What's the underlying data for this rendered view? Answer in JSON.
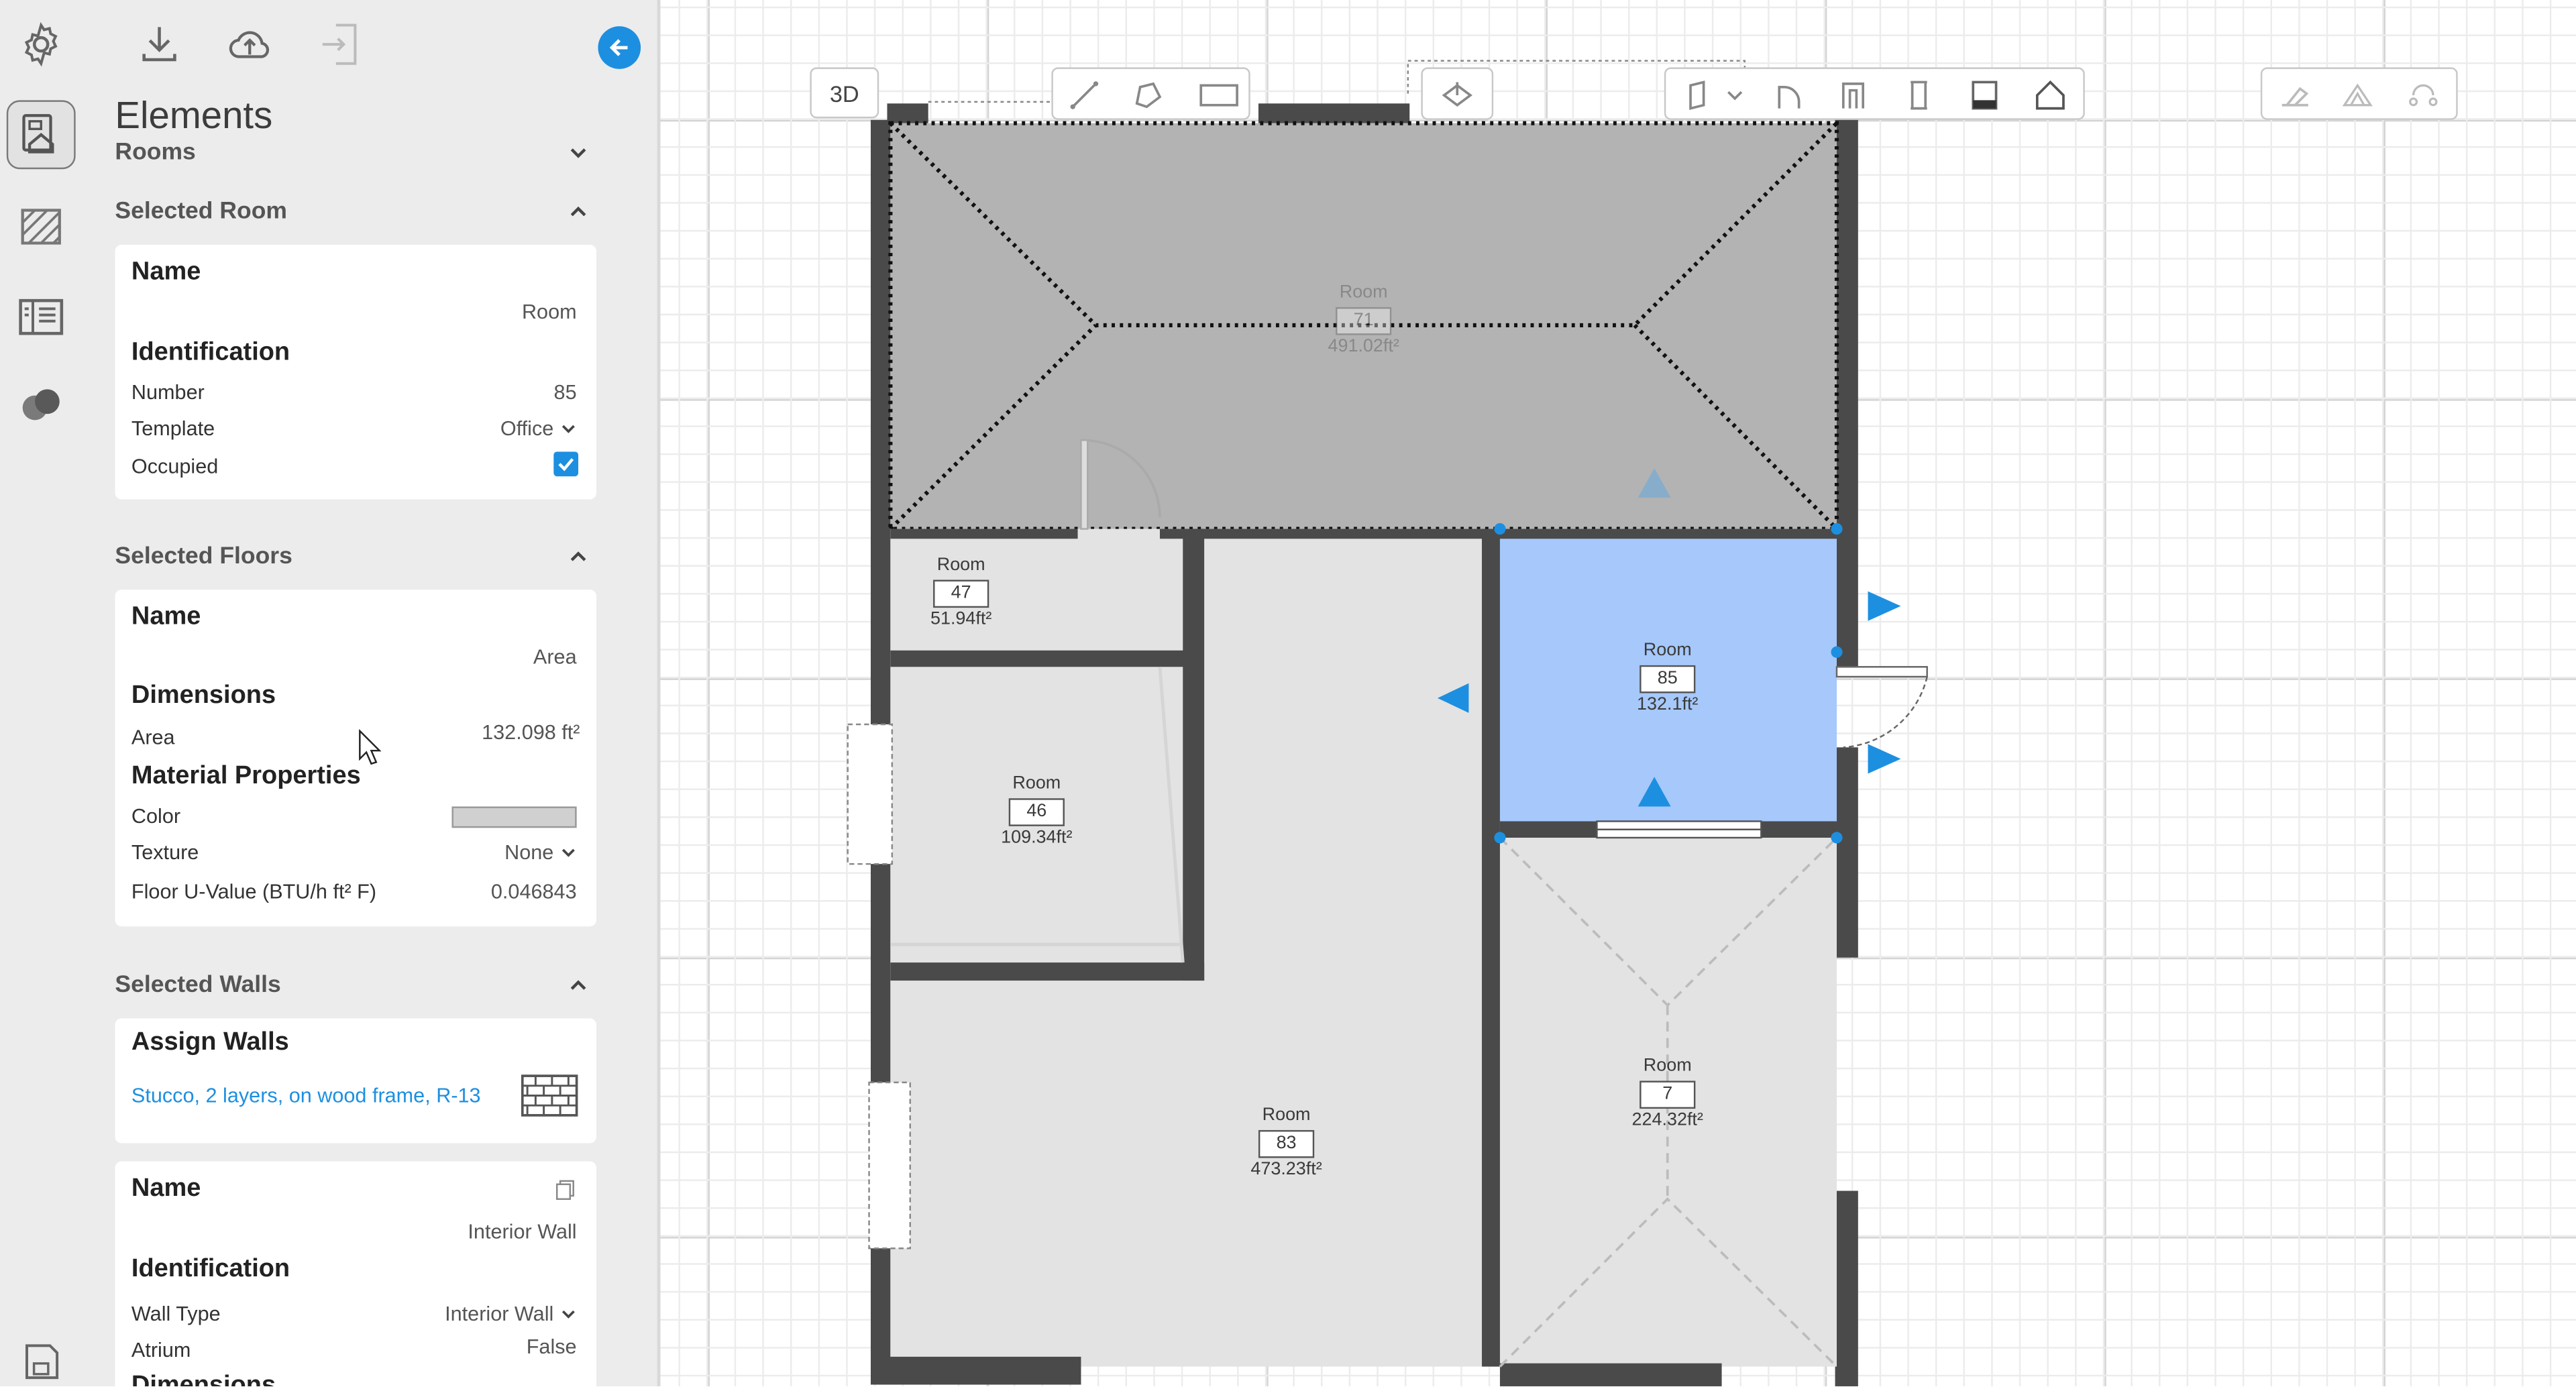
{
  "sidebar": {
    "title": "Elements",
    "rooms_label": "Rooms",
    "selected_room": {
      "header": "Selected Room",
      "name_label": "Name",
      "name_value": "Room",
      "identification_label": "Identification",
      "number_label": "Number",
      "number_value": "85",
      "template_label": "Template",
      "template_value": "Office",
      "occupied_label": "Occupied",
      "occupied": true
    },
    "selected_floors": {
      "header": "Selected Floors",
      "name_label": "Name",
      "name_value": "Area",
      "dimensions_label": "Dimensions",
      "area_label": "Area",
      "area_value": "132.098 ft²",
      "material_label": "Material Properties",
      "color_label": "Color",
      "color_value": "#d0d0d0",
      "texture_label": "Texture",
      "texture_value": "None",
      "uvalue_label": "Floor U-Value (BTU/h ft² F)",
      "uvalue_value": "0.046843"
    },
    "selected_walls": {
      "header": "Selected Walls",
      "assign_label": "Assign Walls",
      "assign_value": "Stucco, 2 layers, on wood frame, R-13",
      "name_label": "Name",
      "name_value": "Interior Wall",
      "identification_label": "Identification",
      "walltype_label": "Wall Type",
      "walltype_value": "Interior Wall",
      "atrium_label": "Atrium",
      "atrium_value": "False",
      "dimensions_label": "Dimensions"
    }
  },
  "toolbar": {
    "view3d_label": "3D"
  },
  "rooms": [
    {
      "label": "Room",
      "number": "71",
      "area": "491.02ft²",
      "faded": true
    },
    {
      "label": "Room",
      "number": "47",
      "area": "51.94ft²"
    },
    {
      "label": "Room",
      "number": "85",
      "area": "132.1ft²",
      "selected": true
    },
    {
      "label": "Room",
      "number": "46",
      "area": "109.34ft²"
    },
    {
      "label": "Room",
      "number": "83",
      "area": "473.23ft²"
    },
    {
      "label": "Room",
      "number": "7",
      "area": "224.32ft²"
    }
  ],
  "colors": {
    "accent": "#1d8fe0",
    "selected_room": "#a6c8fb",
    "wall": "#4a4a4a",
    "roof": "#b3b3b3",
    "floor": "#e3e3e3",
    "link": "#1d8fe0"
  }
}
